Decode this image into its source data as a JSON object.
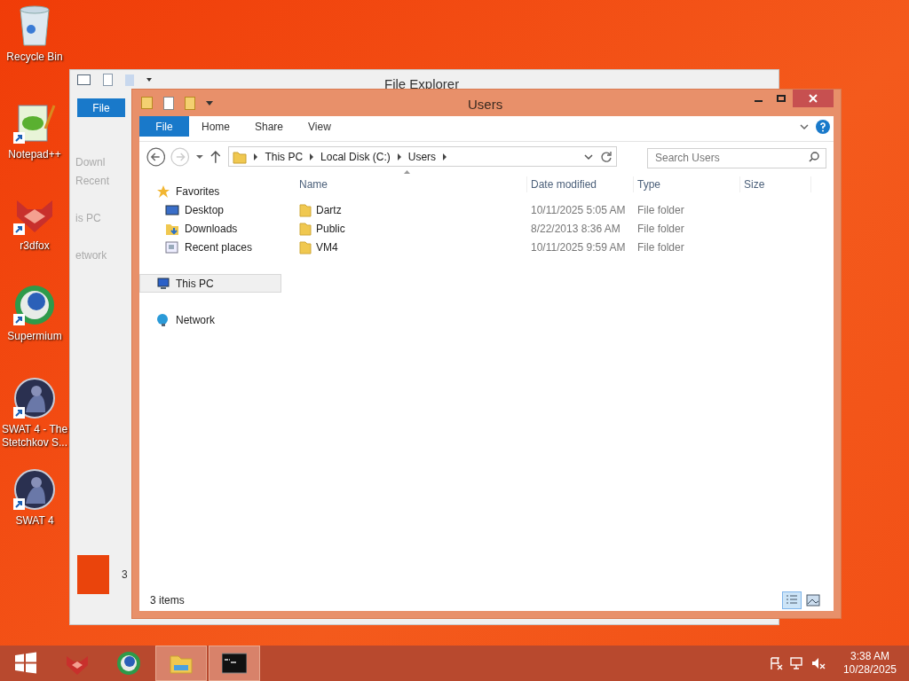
{
  "desktop_icons": [
    {
      "label": "Recycle Bin",
      "kind": "bin",
      "shortcut": false
    },
    {
      "label": "Notepad++",
      "kind": "notepad",
      "shortcut": true
    },
    {
      "label": "r3dfox",
      "kind": "fox",
      "shortcut": true
    },
    {
      "label": "Supermium",
      "kind": "globe",
      "shortcut": true
    },
    {
      "label": "SWAT 4 - The Stetchkov S...",
      "kind": "swat",
      "shortcut": true
    },
    {
      "label": "SWAT 4",
      "kind": "swat",
      "shortcut": true
    }
  ],
  "back_window": {
    "title": "File Explorer",
    "file_tab": "File",
    "nav_items": [
      "Downl",
      "Recent",
      "is PC",
      "etwork"
    ],
    "status": "3"
  },
  "window": {
    "title": "Users",
    "ribbon_tabs": [
      {
        "label": "File",
        "kind": "file"
      },
      {
        "label": "Home",
        "kind": "tab"
      },
      {
        "label": "Share",
        "kind": "tab"
      },
      {
        "label": "View",
        "kind": "tab"
      }
    ],
    "breadcrumb": [
      "This PC",
      "Local Disk (C:)",
      "Users"
    ],
    "search": {
      "placeholder": "Search Users"
    },
    "nav_items": [
      {
        "label": "Favorites",
        "kind": "star",
        "selected": false,
        "children": [
          {
            "label": "Desktop",
            "kind": "desktop",
            "selected": false
          },
          {
            "label": "Downloads",
            "kind": "downloads",
            "selected": false
          },
          {
            "label": "Recent places",
            "kind": "recent",
            "selected": false
          }
        ]
      },
      {
        "label": "This PC",
        "kind": "pc",
        "selected": true
      },
      {
        "label": "Network",
        "kind": "network",
        "selected": false
      }
    ],
    "columns": [
      "Name",
      "Date modified",
      "Type",
      "Size"
    ],
    "rows": [
      {
        "name": "Dartz",
        "date": "10/11/2025 5:05 AM",
        "type": "File folder"
      },
      {
        "name": "Public",
        "date": "8/22/2013 8:36 AM",
        "type": "File folder"
      },
      {
        "name": "VM4",
        "date": "10/11/2025 9:59 AM",
        "type": "File folder"
      }
    ],
    "status": "3 items",
    "views": [
      {
        "kind": "details",
        "selected": true
      },
      {
        "kind": "large",
        "selected": false
      }
    ]
  },
  "taskbar": {
    "items": [
      {
        "kind": "start",
        "open": false
      },
      {
        "kind": "fox",
        "open": false
      },
      {
        "kind": "globe",
        "open": false
      },
      {
        "kind": "explorer",
        "open": true
      },
      {
        "kind": "cmd",
        "open": true
      }
    ],
    "time": "3:38 AM",
    "date": "10/28/2025"
  }
}
